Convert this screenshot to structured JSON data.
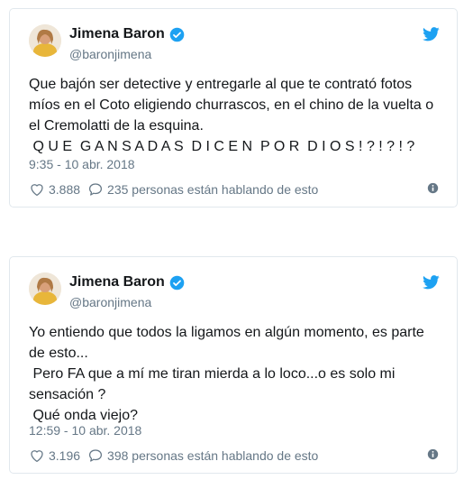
{
  "tweets": [
    {
      "author_name": "Jimena Baron",
      "handle": "@baronjimena",
      "text_lines": [
        "Que bajón ser detective y entregarle al que te contrató fotos míos en el Coto eligiendo churrascos, en el chino de la vuelta o el Cremolatti de la esquina.",
        " Q U E  G A N S A D A S  D I C E N  P O R  D I O S ! ? ! ? ! ?"
      ],
      "timestamp": "9:35 - 10 abr. 2018",
      "likes": "3.888",
      "replies_text": "235 personas están hablando de esto"
    },
    {
      "author_name": "Jimena Baron",
      "handle": "@baronjimena",
      "text_lines": [
        "Yo entiendo que todos la ligamos en algún momento, es parte de esto...",
        " Pero FA que a mí me tiran mierda a lo loco...o es solo mi sensación ?",
        " Qué onda viejo?"
      ],
      "timestamp": "12:59 - 10 abr. 2018",
      "likes": "3.196",
      "replies_text": "398 personas están hablando de esto"
    }
  ],
  "colors": {
    "brand_blue": "#1da1f2",
    "secondary_text": "#657786",
    "border": "#e1e8ed"
  },
  "icons": [
    "avatar",
    "verified-badge-icon",
    "twitter-bird-icon",
    "heart-icon",
    "reply-bubble-icon",
    "info-icon"
  ]
}
